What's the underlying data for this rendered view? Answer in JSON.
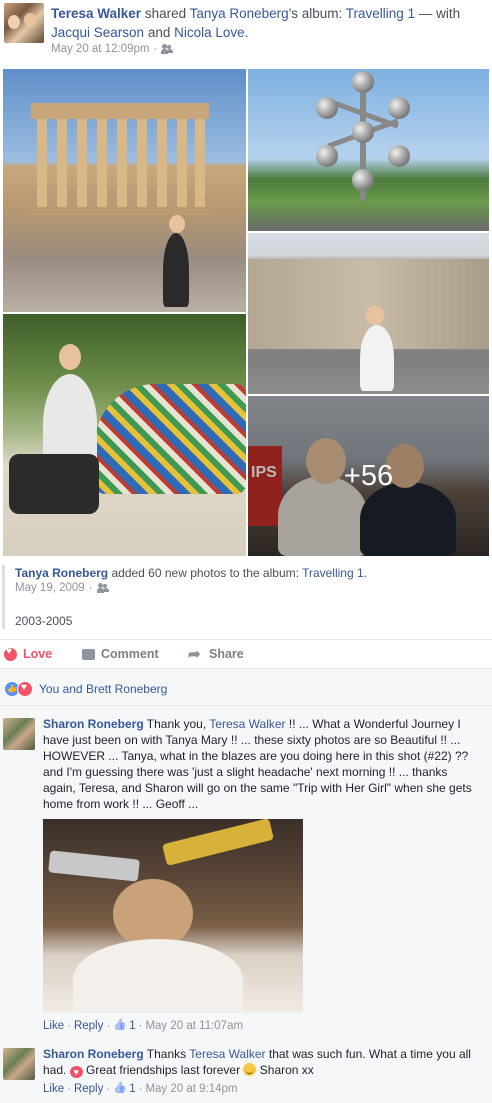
{
  "post": {
    "author": "Teresa Walker",
    "shared_word": " shared ",
    "album_owner": "Tanya Roneberg",
    "possessive": "'s album: ",
    "album_name": "Travelling 1",
    "with_text": " — with ",
    "tagged1": "Jacqui Searson",
    "and_text": " and ",
    "tagged2": "Nicola Love",
    "end_period": ".",
    "timestamp": "May 20 at 12:09pm",
    "privacy_icon": "people-icon"
  },
  "photos": {
    "more_count": "+56",
    "sign_text": "IPS"
  },
  "shared_album": {
    "owner": "Tanya Roneberg",
    "action_text": " added 60 new photos to the album: ",
    "album_name": "Travelling 1",
    "end_period": ".",
    "date": "May 19, 2009",
    "description": "2003-2005"
  },
  "actions": {
    "love": "Love",
    "comment": "Comment",
    "share": "Share"
  },
  "reactions": {
    "text": "You and Brett Roneberg",
    "colors": {
      "like": "#5890ff",
      "love": "#f25268"
    }
  },
  "comments": [
    {
      "author": "Sharon Roneberg",
      "text_before": " Thank you, ",
      "mention": "Teresa Walker",
      "text_after": " !! ... What a Wonderful Journey I have just been on with Tanya Mary !! ... these sixty photos are so Beautiful !! ... HOWEVER ... Tanya, what in the blazes are you doing here in this shot (#22) ?? and I'm guessing there was 'just a slight headache' next morning !! ... thanks again, Teresa, and Sharon will go on the same \"Trip with Her Girl\" when she gets home from work !! ... Geoff ...",
      "like_label": "Like",
      "reply_label": "Reply",
      "like_count": "1",
      "time": "May 20 at 11:07am"
    },
    {
      "author": "Sharon Roneberg",
      "text_before": " Thanks ",
      "mention": "Teresa Walker",
      "text_mid": " that was such fun. What a time you all had. ",
      "text_mid2": " Great friendships last forever ",
      "text_end": " Sharon xx",
      "like_label": "Like",
      "reply_label": "Reply",
      "like_count": "1",
      "time": "May 20 at 9:14pm"
    }
  ],
  "separator": " · ",
  "accent_color": "#365899"
}
